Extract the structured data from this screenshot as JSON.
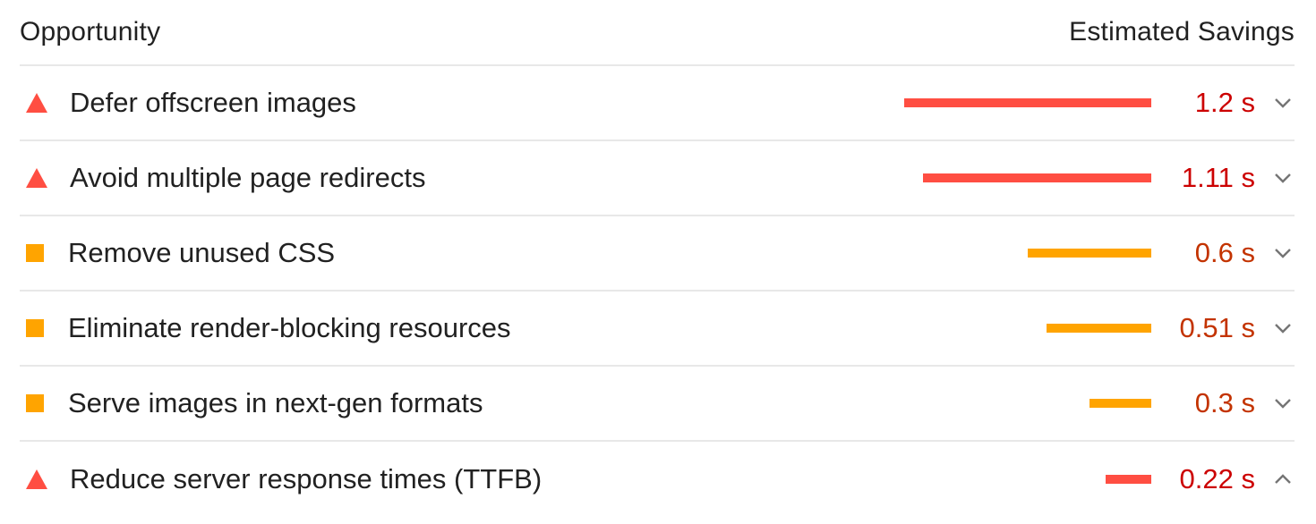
{
  "header": {
    "opportunity_label": "Opportunity",
    "savings_label": "Estimated Savings"
  },
  "colors": {
    "fail": "#ff4e42",
    "fail_text": "#cc0000",
    "average": "#ffa400",
    "average_text": "#c33300",
    "chevron": "#757575"
  },
  "max_savings_s": 1.2,
  "audits": [
    {
      "title": "Defer offscreen images",
      "savings_label": "1.2 s",
      "savings_s": 1.2,
      "status": "fail",
      "icon": "red-triangle-icon",
      "expanded": false
    },
    {
      "title": "Avoid multiple page redirects",
      "savings_label": "1.11 s",
      "savings_s": 1.11,
      "status": "fail",
      "icon": "red-triangle-icon",
      "expanded": false
    },
    {
      "title": "Remove unused CSS",
      "savings_label": "0.6 s",
      "savings_s": 0.6,
      "status": "average",
      "icon": "orange-square-icon",
      "expanded": false
    },
    {
      "title": "Eliminate render-blocking resources",
      "savings_label": "0.51 s",
      "savings_s": 0.51,
      "status": "average",
      "icon": "orange-square-icon",
      "expanded": false
    },
    {
      "title": "Serve images in next-gen formats",
      "savings_label": "0.3 s",
      "savings_s": 0.3,
      "status": "average",
      "icon": "orange-square-icon",
      "expanded": false
    },
    {
      "title": "Reduce server response times (TTFB)",
      "savings_label": "0.22 s",
      "savings_s": 0.22,
      "status": "fail",
      "icon": "red-triangle-icon",
      "expanded": true
    }
  ]
}
